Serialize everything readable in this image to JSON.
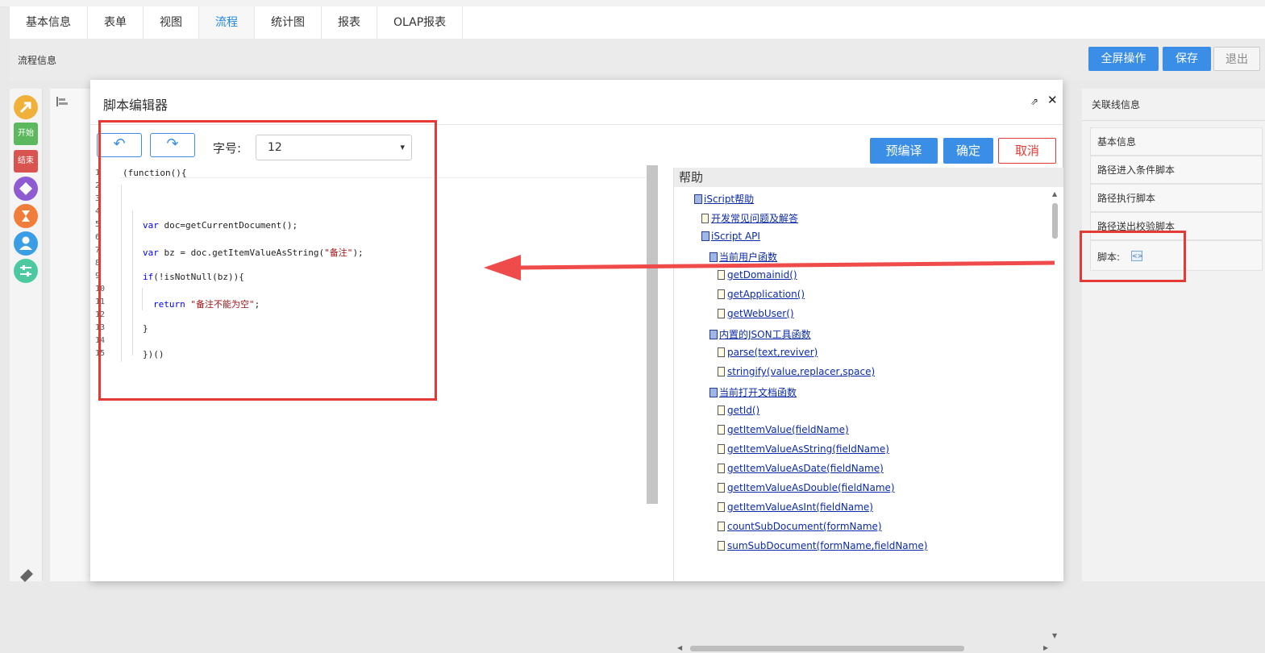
{
  "tabs": [
    "基本信息",
    "表单",
    "视图",
    "流程",
    "统计图",
    "报表",
    "OLAP报表"
  ],
  "active_tab": "流程",
  "subbar": {
    "label": "流程信息"
  },
  "toolbar": {
    "fullscreen": "全屏操作",
    "save": "保存",
    "exit": "退出"
  },
  "palette": {
    "start": "开始",
    "end": "结束"
  },
  "right_panel": {
    "title": "关联线信息",
    "items": [
      "基本信息",
      "路径进入条件脚本",
      "路径执行脚本",
      "路径送出校验脚本"
    ],
    "script_label": "脚本:"
  },
  "dialog": {
    "title": "脚本编辑器",
    "font_size_label": "字号:",
    "font_size_value": "12",
    "precompile": "预编译",
    "confirm": "确定",
    "cancel": "取消"
  },
  "editor": {
    "line_numbers": [
      "1",
      "2",
      "3",
      "4",
      "5",
      "6",
      "7",
      "8",
      "9",
      "10",
      "11",
      "12",
      "13",
      "14",
      "15"
    ],
    "lines": {
      "l1": "(function(){",
      "l5a": "var",
      "l5b": " doc=getCurrentDocument();",
      "l7a": "var",
      "l7b": " bz = doc.getItemValueAsString(",
      "l7c": "\"备注\"",
      "l7d": ");",
      "l9a": "if",
      "l9b": "(!isNotNull(bz)){",
      "l11a": "return",
      "l11b": " ",
      "l11c": "\"备注不能为空\"",
      "l11d": ";",
      "l13": "}",
      "l15": "})()"
    }
  },
  "help": {
    "title": "帮助",
    "items": [
      "iScript帮助",
      "开发常见问题及解答",
      "iScript API",
      "当前用户函数",
      "getDomainid()",
      "getApplication()",
      "getWebUser()",
      "内置的JSON工具函数",
      "parse(text,reviver)",
      "stringify(value,replacer,space)",
      "当前打开文档函数",
      "getId()",
      "getItemValue(fieldName)",
      "getItemValueAsString(fieldName)",
      "getItemValueAsDate(fieldName)",
      "getItemValueAsDouble(fieldName)",
      "getItemValueAsInt(fieldName)",
      "countSubDocument(formName)",
      "sumSubDocument(formName,fieldName)"
    ]
  }
}
